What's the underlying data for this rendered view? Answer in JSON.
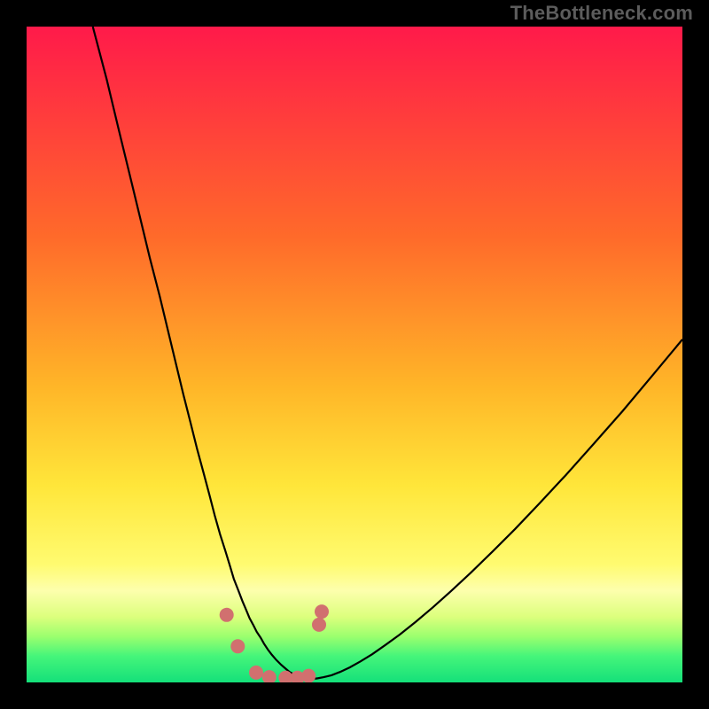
{
  "watermark": "TheBottleneck.com",
  "chart_data": {
    "type": "line",
    "title": "",
    "xlabel": "",
    "ylabel": "",
    "xlim": [
      0,
      100
    ],
    "ylim": [
      0,
      100
    ],
    "grid": false,
    "legend": false,
    "background_gradient": {
      "stops": [
        {
          "offset": 0.0,
          "color": "#ff1a4a"
        },
        {
          "offset": 0.32,
          "color": "#ff6a2a"
        },
        {
          "offset": 0.55,
          "color": "#ffb628"
        },
        {
          "offset": 0.7,
          "color": "#ffe63a"
        },
        {
          "offset": 0.82,
          "color": "#fffb70"
        },
        {
          "offset": 0.86,
          "color": "#fdffad"
        },
        {
          "offset": 0.9,
          "color": "#dcff7d"
        },
        {
          "offset": 0.93,
          "color": "#9bff6e"
        },
        {
          "offset": 0.96,
          "color": "#45f57a"
        },
        {
          "offset": 1.0,
          "color": "#14e07a"
        }
      ]
    },
    "series": [
      {
        "name": "curve",
        "color": "#000000",
        "x": [
          10.1,
          12.2,
          14.0,
          15.7,
          17.3,
          18.8,
          20.3,
          21.6,
          22.8,
          23.9,
          25.0,
          26.0,
          27.0,
          27.9,
          28.7,
          29.5,
          30.3,
          31.0,
          31.6,
          32.3,
          32.9,
          33.5,
          34.0,
          34.6,
          35.1,
          35.7,
          36.2,
          36.8,
          37.4,
          38.1,
          38.8,
          39.5,
          40.1,
          40.8,
          41.6,
          42.4,
          43.2,
          44.2,
          45.3,
          46.5,
          47.8,
          49.3,
          50.9,
          52.7,
          54.7,
          56.9,
          59.3,
          61.9,
          64.7,
          67.7,
          71.0,
          74.5,
          78.2,
          82.2,
          86.4,
          90.9,
          95.6,
          100.0
        ],
        "y": [
          100.0,
          92.0,
          84.5,
          77.5,
          70.9,
          64.7,
          58.9,
          53.5,
          48.5,
          43.9,
          39.6,
          35.6,
          31.9,
          28.5,
          25.4,
          22.6,
          20.1,
          17.8,
          15.8,
          14.0,
          12.4,
          11.0,
          9.8,
          8.7,
          7.7,
          6.8,
          5.9,
          5.0,
          4.2,
          3.4,
          2.7,
          2.1,
          1.6,
          1.2,
          0.9,
          0.7,
          0.6,
          0.6,
          0.8,
          1.1,
          1.6,
          2.3,
          3.2,
          4.3,
          5.7,
          7.3,
          9.2,
          11.4,
          13.9,
          16.7,
          19.9,
          23.4,
          27.3,
          31.6,
          36.3,
          41.4,
          47.0,
          52.3
        ]
      }
    ],
    "markers": {
      "color": "#d1706f",
      "points": [
        {
          "x": 30.5,
          "y": 10.3
        },
        {
          "x": 32.2,
          "y": 5.5
        },
        {
          "x": 35.0,
          "y": 1.5
        },
        {
          "x": 37.0,
          "y": 0.8
        },
        {
          "x": 39.5,
          "y": 0.7
        },
        {
          "x": 41.3,
          "y": 0.7
        },
        {
          "x": 43.0,
          "y": 1.0
        },
        {
          "x": 44.6,
          "y": 8.8
        },
        {
          "x": 45.0,
          "y": 10.8
        }
      ]
    }
  }
}
